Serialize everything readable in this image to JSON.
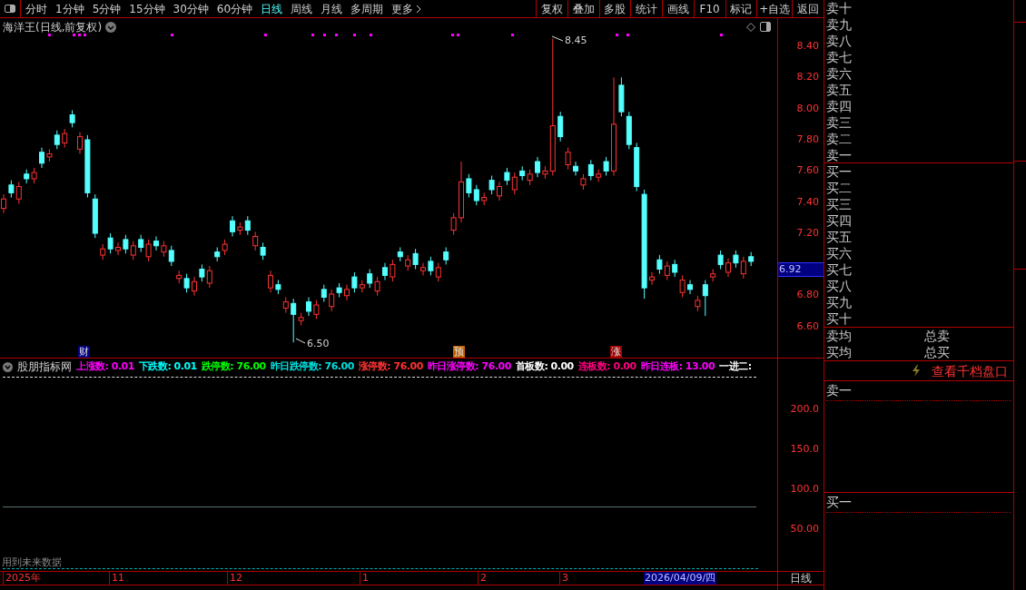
{
  "toolbar": {
    "periods": [
      {
        "label": "分时",
        "selected": false
      },
      {
        "label": "1分钟",
        "selected": false
      },
      {
        "label": "5分钟",
        "selected": false
      },
      {
        "label": "15分钟",
        "selected": false
      },
      {
        "label": "30分钟",
        "selected": false
      },
      {
        "label": "60分钟",
        "selected": false
      },
      {
        "label": "日线",
        "selected": true
      },
      {
        "label": "周线",
        "selected": false
      },
      {
        "label": "月线",
        "selected": false
      },
      {
        "label": "多周期",
        "selected": false
      },
      {
        "label": "更多",
        "selected": false
      }
    ],
    "actions": [
      "复权",
      "叠加",
      "多股",
      "统计",
      "画线",
      "F10",
      "标记",
      "+自选",
      "返回"
    ]
  },
  "chart": {
    "title": "海洋王(日线,前复权)",
    "high_marker": "8.45",
    "low_marker": "6.50",
    "events": [
      {
        "label": "财",
        "color": "#000080"
      },
      {
        "label": "预",
        "color": "#c06000"
      },
      {
        "label": "涨",
        "color": "#a00000"
      }
    ],
    "price_axis": [
      "8.40",
      "8.20",
      "8.00",
      "7.80",
      "7.60",
      "7.40",
      "7.20",
      "6.80",
      "6.60"
    ],
    "current_price": "6.92",
    "chart_data": {
      "type": "candlestick",
      "ohlc": [
        [
          7.36,
          7.45,
          7.33,
          7.42
        ],
        [
          7.51,
          7.54,
          7.43,
          7.46
        ],
        [
          7.42,
          7.53,
          7.39,
          7.5
        ],
        [
          7.58,
          7.61,
          7.52,
          7.55
        ],
        [
          7.55,
          7.62,
          7.52,
          7.59
        ],
        [
          7.72,
          7.75,
          7.62,
          7.65
        ],
        [
          7.69,
          7.74,
          7.66,
          7.71
        ],
        [
          7.83,
          7.86,
          7.74,
          7.77
        ],
        [
          7.78,
          7.87,
          7.75,
          7.84
        ],
        [
          7.96,
          7.99,
          7.88,
          7.91
        ],
        [
          7.74,
          7.85,
          7.71,
          7.82
        ],
        [
          7.8,
          7.83,
          7.43,
          7.46
        ],
        [
          7.42,
          7.45,
          7.17,
          7.2
        ],
        [
          7.06,
          7.13,
          7.03,
          7.1
        ],
        [
          7.17,
          7.2,
          7.07,
          7.1
        ],
        [
          7.09,
          7.14,
          7.06,
          7.11
        ],
        [
          7.16,
          7.19,
          7.07,
          7.1
        ],
        [
          7.06,
          7.15,
          7.03,
          7.12
        ],
        [
          7.16,
          7.19,
          7.08,
          7.11
        ],
        [
          7.05,
          7.16,
          7.02,
          7.13
        ],
        [
          7.15,
          7.18,
          7.09,
          7.12
        ],
        [
          7.08,
          7.15,
          7.05,
          7.12
        ],
        [
          7.09,
          7.12,
          6.99,
          7.02
        ],
        [
          6.91,
          6.96,
          6.88,
          6.93
        ],
        [
          6.91,
          6.94,
          6.82,
          6.85
        ],
        [
          6.83,
          6.92,
          6.8,
          6.89
        ],
        [
          6.97,
          7.0,
          6.89,
          6.92
        ],
        [
          6.88,
          6.99,
          6.85,
          6.96
        ],
        [
          7.08,
          7.11,
          7.02,
          7.05
        ],
        [
          7.09,
          7.16,
          7.06,
          7.13
        ],
        [
          7.28,
          7.31,
          7.18,
          7.21
        ],
        [
          7.22,
          7.27,
          7.19,
          7.24
        ],
        [
          7.28,
          7.31,
          7.19,
          7.22
        ],
        [
          7.12,
          7.21,
          7.09,
          7.18
        ],
        [
          7.11,
          7.14,
          7.03,
          7.06
        ],
        [
          6.85,
          6.96,
          6.82,
          6.93
        ],
        [
          6.87,
          6.9,
          6.81,
          6.84
        ],
        [
          6.72,
          6.79,
          6.69,
          6.76
        ],
        [
          6.75,
          6.78,
          6.5,
          6.68
        ],
        [
          6.64,
          6.69,
          6.61,
          6.66
        ],
        [
          6.76,
          6.79,
          6.67,
          6.7
        ],
        [
          6.68,
          6.77,
          6.65,
          6.74
        ],
        [
          6.84,
          6.87,
          6.76,
          6.79
        ],
        [
          6.73,
          6.84,
          6.7,
          6.81
        ],
        [
          6.85,
          6.88,
          6.79,
          6.82
        ],
        [
          6.8,
          6.87,
          6.77,
          6.84
        ],
        [
          6.92,
          6.95,
          6.82,
          6.85
        ],
        [
          6.85,
          6.9,
          6.82,
          6.87
        ],
        [
          6.94,
          6.97,
          6.85,
          6.88
        ],
        [
          6.83,
          6.92,
          6.8,
          6.89
        ],
        [
          6.98,
          7.01,
          6.9,
          6.93
        ],
        [
          6.92,
          7.03,
          6.89,
          7.0
        ],
        [
          7.08,
          7.11,
          7.02,
          7.05
        ],
        [
          6.99,
          7.06,
          6.96,
          7.03
        ],
        [
          7.07,
          7.1,
          6.97,
          7.0
        ],
        [
          6.96,
          7.01,
          6.93,
          6.98
        ],
        [
          7.02,
          7.05,
          6.93,
          6.96
        ],
        [
          6.92,
          7.01,
          6.89,
          6.98
        ],
        [
          7.08,
          7.11,
          7.0,
          7.03
        ],
        [
          7.22,
          7.33,
          7.19,
          7.3
        ],
        [
          7.3,
          7.66,
          7.27,
          7.53
        ],
        [
          7.55,
          7.58,
          7.43,
          7.46
        ],
        [
          7.48,
          7.51,
          7.38,
          7.41
        ],
        [
          7.41,
          7.46,
          7.38,
          7.43
        ],
        [
          7.54,
          7.57,
          7.45,
          7.48
        ],
        [
          7.44,
          7.53,
          7.41,
          7.5
        ],
        [
          7.59,
          7.62,
          7.51,
          7.54
        ],
        [
          7.48,
          7.59,
          7.45,
          7.56
        ],
        [
          7.6,
          7.63,
          7.54,
          7.57
        ],
        [
          7.54,
          7.61,
          7.51,
          7.58
        ],
        [
          7.66,
          7.69,
          7.56,
          7.59
        ],
        [
          7.58,
          7.63,
          7.55,
          7.6
        ],
        [
          7.6,
          8.45,
          7.57,
          7.89
        ],
        [
          7.95,
          7.98,
          7.79,
          7.82
        ],
        [
          7.64,
          7.75,
          7.61,
          7.72
        ],
        [
          7.63,
          7.66,
          7.57,
          7.6
        ],
        [
          7.51,
          7.58,
          7.48,
          7.55
        ],
        [
          7.64,
          7.67,
          7.54,
          7.57
        ],
        [
          7.56,
          7.61,
          7.53,
          7.58
        ],
        [
          7.66,
          7.69,
          7.57,
          7.6
        ],
        [
          7.6,
          8.2,
          7.57,
          7.9
        ],
        [
          8.15,
          8.2,
          7.95,
          7.98
        ],
        [
          7.95,
          7.98,
          7.74,
          7.77
        ],
        [
          7.75,
          7.78,
          7.47,
          7.5
        ],
        [
          7.45,
          7.48,
          6.78,
          6.85
        ],
        [
          6.9,
          6.95,
          6.87,
          6.92
        ],
        [
          7.03,
          7.06,
          6.94,
          6.97
        ],
        [
          6.93,
          7.02,
          6.9,
          6.99
        ],
        [
          7.0,
          7.03,
          6.92,
          6.95
        ],
        [
          6.82,
          6.93,
          6.79,
          6.9
        ],
        [
          6.87,
          6.9,
          6.81,
          6.84
        ],
        [
          6.73,
          6.8,
          6.7,
          6.77
        ],
        [
          6.87,
          6.9,
          6.67,
          6.8
        ],
        [
          6.92,
          6.97,
          6.89,
          6.94
        ],
        [
          7.06,
          7.09,
          6.97,
          7.0
        ],
        [
          6.95,
          7.04,
          6.92,
          7.01
        ],
        [
          7.06,
          7.09,
          6.98,
          7.01
        ],
        [
          6.94,
          7.05,
          6.91,
          7.02
        ],
        [
          7.05,
          7.08,
          6.99,
          7.02
        ]
      ]
    }
  },
  "indicator": {
    "name": "股朋指标网",
    "legend": [
      {
        "text": "上涨数: 0.01",
        "color": "#ff00ff"
      },
      {
        "text": "下跌数: 0.01",
        "color": "#00ffff"
      },
      {
        "text": "跌停数: 76.00",
        "color": "#00ff00"
      },
      {
        "text": "昨日跌停数: 76.00",
        "color": "#00e0e0"
      },
      {
        "text": "涨停数: 76.00",
        "color": "#ff3232"
      },
      {
        "text": "昨日涨停数: 76.00",
        "color": "#ff00ff"
      },
      {
        "text": "首板数: 0.00",
        "color": "#ffffff"
      },
      {
        "text": "连板数: 0.00",
        "color": "#ff0080"
      },
      {
        "text": "昨日连板: 13.00",
        "color": "#ff00ff"
      },
      {
        "text": "一进二:",
        "color": "#ffffff"
      }
    ],
    "axis": [
      "200.0",
      "150.0",
      "100.0",
      "50.00"
    ],
    "note": "用到未来数据"
  },
  "date_axis": {
    "labels": [
      "2025年",
      "11",
      "12",
      "1",
      "2",
      "3"
    ],
    "cursor_date": "2026/04/09/四",
    "period": "日线"
  },
  "order_book": {
    "asks": [
      "卖十",
      "卖九",
      "卖八",
      "卖七",
      "卖六",
      "卖五",
      "卖四",
      "卖三",
      "卖二",
      "卖一"
    ],
    "bids": [
      "买一",
      "买二",
      "买三",
      "买四",
      "买五",
      "买六",
      "买七",
      "买八",
      "买九",
      "买十"
    ],
    "summary": [
      [
        "卖均",
        "总卖"
      ],
      [
        "买均",
        "总买"
      ]
    ],
    "depth_button": "查看千档盘口",
    "depth_ask": "卖一",
    "depth_bid": "买一"
  }
}
